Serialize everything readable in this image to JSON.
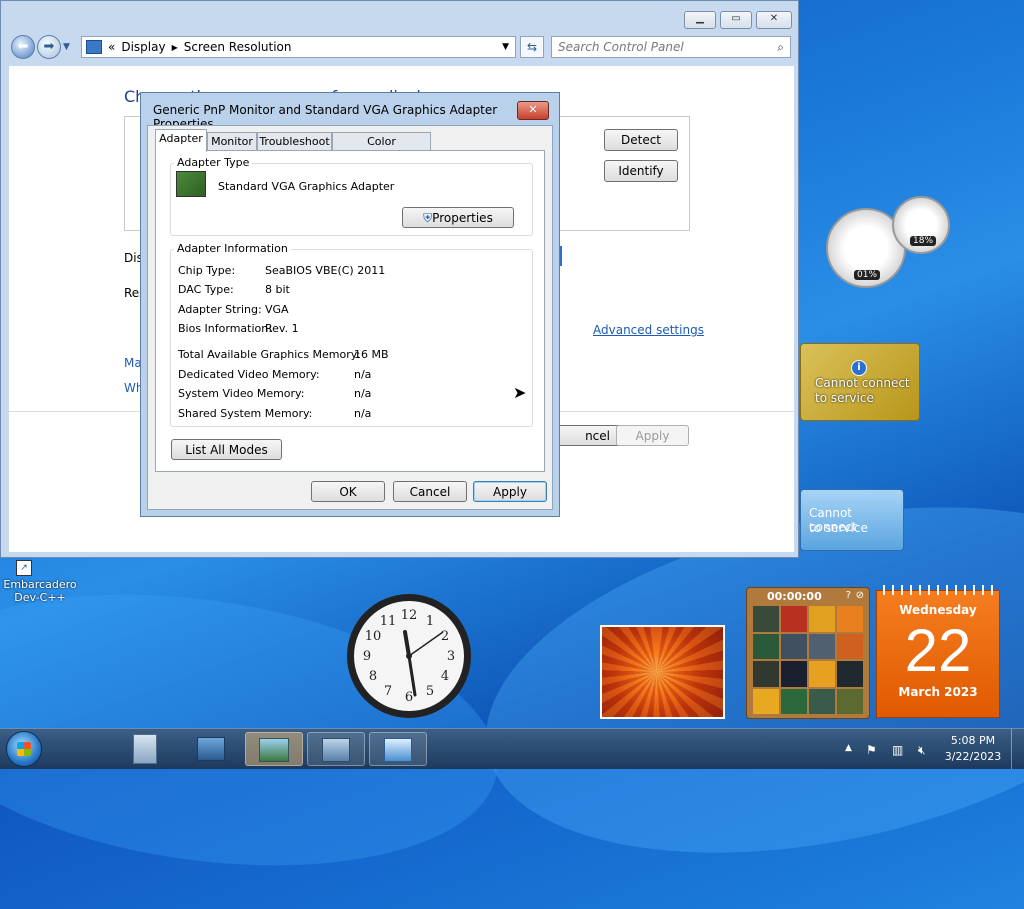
{
  "control_panel": {
    "breadcrumb_prefix": "«",
    "breadcrumb": [
      "Display",
      "Screen Resolution"
    ],
    "search_placeholder": "Search Control Panel",
    "heading": "Change the appearance of your display",
    "display_label": "Dis",
    "resolution_label": "Res",
    "link_make": "Ma",
    "link_what": "Wh",
    "detect_button": "Detect",
    "identify_button": "Identify",
    "advanced_settings_link": "Advanced settings",
    "cancel_button": "ncel",
    "apply_button": "Apply"
  },
  "dialog": {
    "title": "Generic PnP Monitor and Standard VGA Graphics Adapter Properties",
    "tabs": [
      "Adapter",
      "Monitor",
      "Troubleshoot",
      "Color Management"
    ],
    "active_tab": "Adapter",
    "adapter_type_label": "Adapter Type",
    "adapter_name": "Standard VGA Graphics Adapter",
    "properties_button": "Properties",
    "adapter_info_label": "Adapter Information",
    "info_rows": [
      {
        "label": "Chip Type:",
        "value": "SeaBIOS VBE(C) 2011"
      },
      {
        "label": "DAC Type:",
        "value": "8 bit"
      },
      {
        "label": "Adapter String:",
        "value": "VGA"
      },
      {
        "label": "Bios Information:",
        "value": "Rev. 1"
      }
    ],
    "memory_rows": [
      {
        "label": "Total Available Graphics Memory:",
        "value": "16 MB"
      },
      {
        "label": "Dedicated Video Memory:",
        "value": "n/a"
      },
      {
        "label": "System Video Memory:",
        "value": "n/a"
      },
      {
        "label": "Shared System Memory:",
        "value": "n/a"
      }
    ],
    "list_all_modes_button": "List All Modes",
    "ok_button": "OK",
    "cancel_button": "Cancel",
    "apply_button": "Apply"
  },
  "desktop": {
    "shortcut_label_line1": "Embarcadero",
    "shortcut_label_line2": "Dev-C++"
  },
  "gadgets": {
    "cpu_meter_cpu": "01%",
    "cpu_meter_mem": "18%",
    "weather_message_line1": "Cannot connect",
    "weather_message_line2": "to service",
    "feed_message_line1": "Cannot connect",
    "feed_message_line2": "to service",
    "puzzle_timer": "00:00:00",
    "calendar_weekday": "Wednesday",
    "calendar_day": "22",
    "calendar_month_year": "March 2023",
    "clock_numbers": [
      "12",
      "1",
      "2",
      "3",
      "4",
      "5",
      "6",
      "7",
      "8",
      "9",
      "10",
      "11"
    ]
  },
  "taskbar": {
    "time": "5:08 PM",
    "date": "3/22/2023"
  },
  "colors": {
    "accent": "#1e5bb8",
    "calendar": "#f07010",
    "weather_gadget": "#c8a820"
  }
}
